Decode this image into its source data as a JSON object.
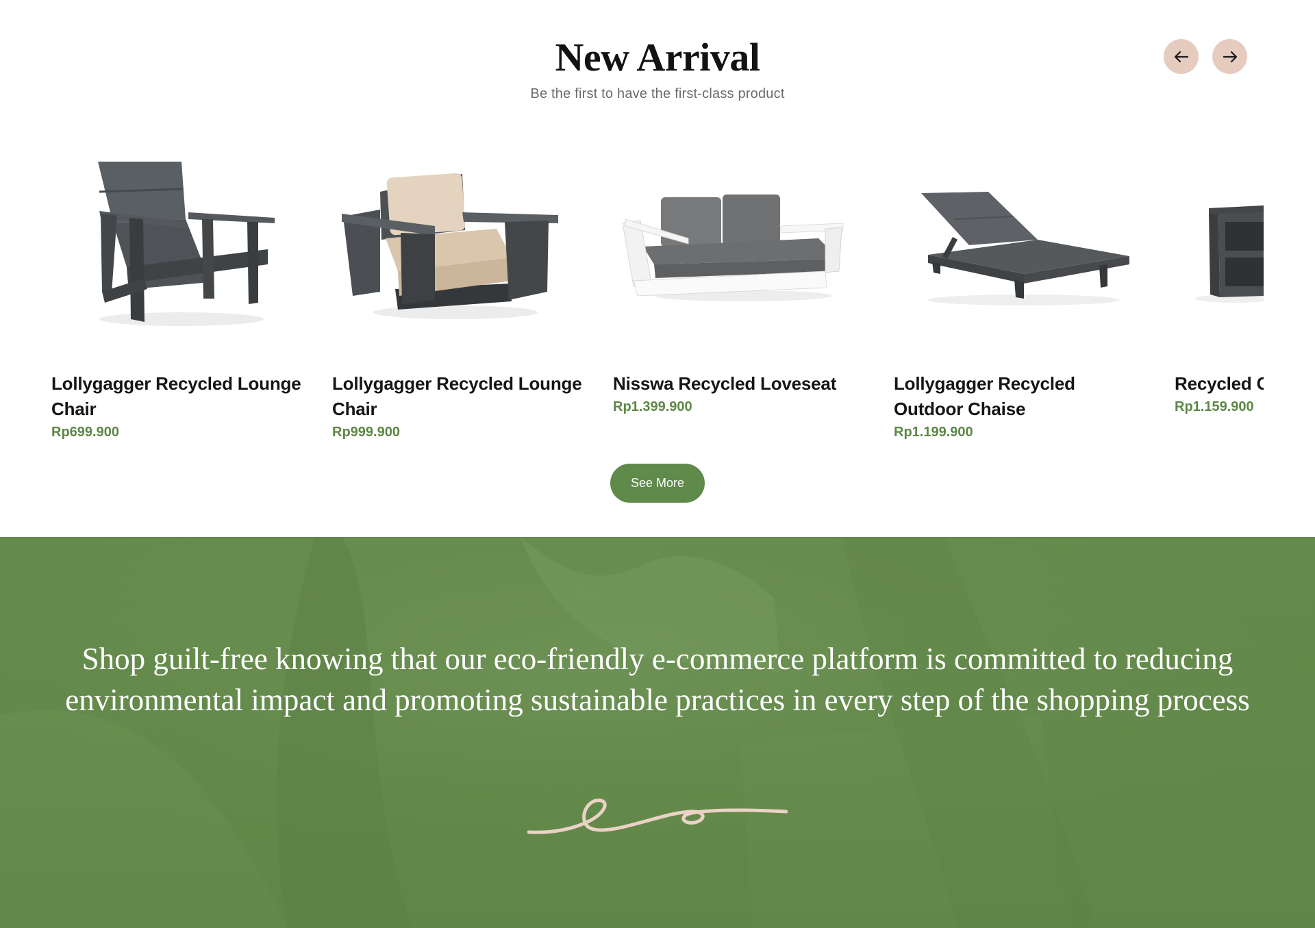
{
  "arrival": {
    "title": "New Arrival",
    "subtitle": "Be the first to have the first-class product",
    "prev_icon": "arrow-left-icon",
    "next_icon": "arrow-right-icon",
    "see_more_label": "See More"
  },
  "products": [
    {
      "name": "Lollygagger Recycled Lounge Chair",
      "price": "Rp699.900",
      "image": "adirondack-chair"
    },
    {
      "name": "Lollygagger Recycled Lounge Chair",
      "price": "Rp999.900",
      "image": "cushioned-armchair"
    },
    {
      "name": "Nisswa Recycled Loveseat",
      "price": "Rp1.399.900",
      "image": "loveseat"
    },
    {
      "name": "Lollygagger Recycled Outdoor Chaise",
      "price": "Rp1.199.900",
      "image": "chaise-lounge"
    },
    {
      "name": "Recycled C",
      "price": "Rp1.159.900",
      "image": "side-table"
    }
  ],
  "banner": {
    "text": "Shop guilt-free knowing that our eco-friendly e-commerce platform is committed to reducing environmental impact and promoting sustainable practices in every step of the shopping process"
  },
  "colors": {
    "accent_green": "#5f8a4a",
    "price_green": "#5d8746",
    "nav_button": "#e6cbbf",
    "banner_bg": "#658b4c",
    "flourish": "#ead2c6"
  }
}
